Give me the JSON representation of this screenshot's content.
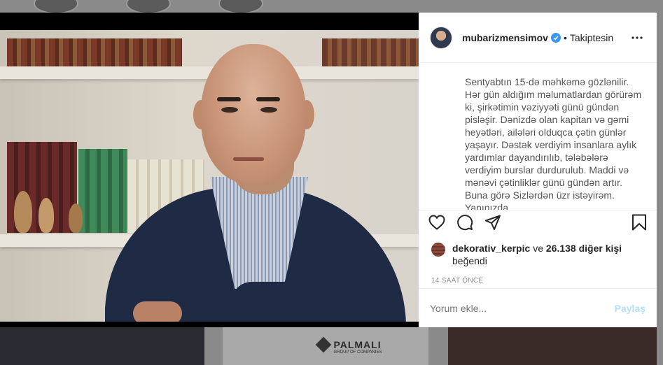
{
  "post": {
    "username": "mubarizmensimov",
    "follow_separator": "•",
    "follow_label": "Takiptesin",
    "caption": "Sentyabtın 15-də məhkəmə gözlənilir. Hər gün aldığım məlumatlardan görürəm ki, şirkətimin vəziyyəti günü gündən pisləşir. Dənizdə olan kapitan və gəmi heyətləri, ailələri olduqca çətin günlər yaşayır. Dəstək verdiyim insanlara aylık yardımlar dayandırılıb, tələbələrə verdiyim burslar durdurulub. Maddi və mənəvi çətinliklər günü gündən artır. Buna görə Sizlərdən üzr istəyirəm. Yanınızda",
    "likes": {
      "liker": "dekorativ_kerpic",
      "connector": "ve",
      "others": "26.138 diğer kişi",
      "suffix": "beğendi"
    },
    "timestamp": "14 SAAT ÖNCE",
    "comment_placeholder": "Yorum ekle...",
    "post_button": "Paylaş"
  },
  "background": {
    "logo_text": "PALMALI",
    "logo_sub": "GROUP OF COMPANIES"
  },
  "icons": {
    "verified": "verified-badge-icon",
    "more": "more-options-icon",
    "like": "heart-icon",
    "comment": "comment-icon",
    "share": "share-icon",
    "save": "bookmark-icon"
  },
  "colors": {
    "verified": "#3897f0",
    "post_button_disabled": "#b2dffc",
    "overlay": "#8a8a8a"
  }
}
